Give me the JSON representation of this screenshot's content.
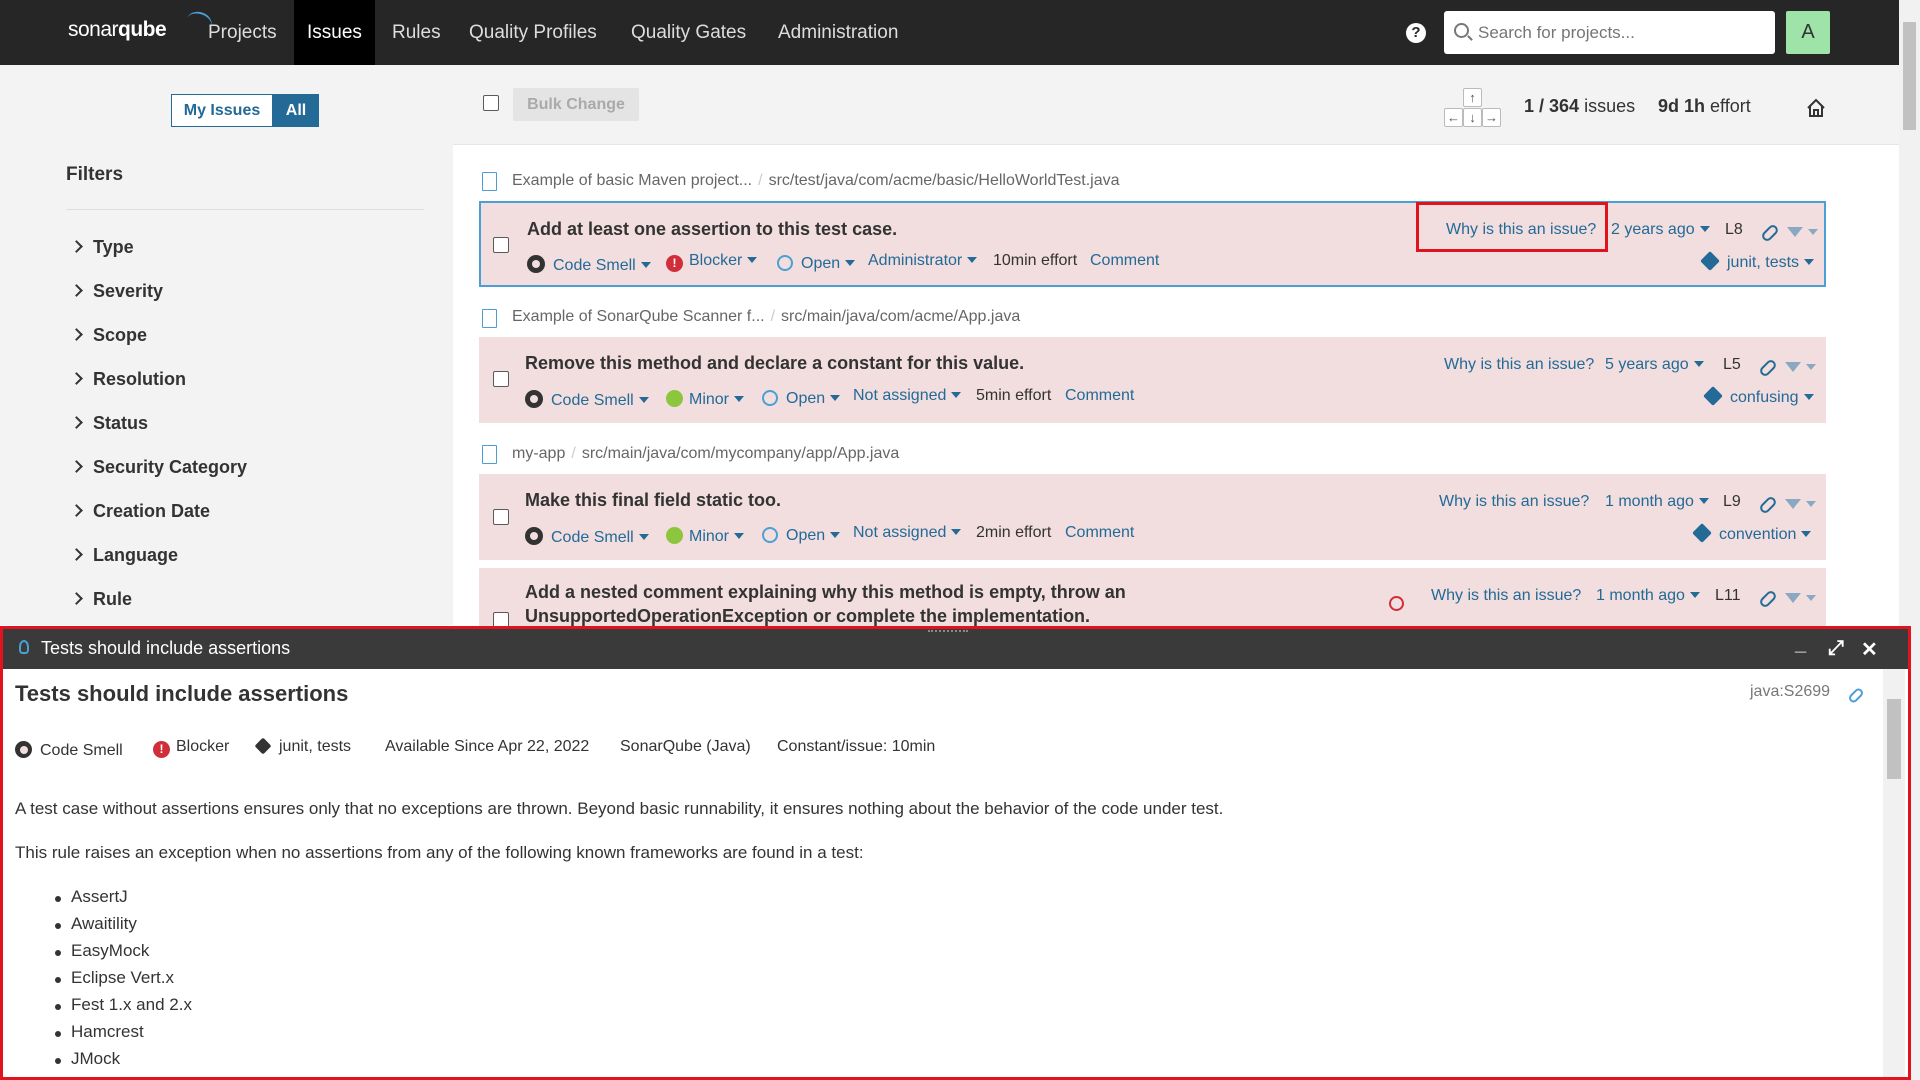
{
  "nav": {
    "logo_a": "sonar",
    "logo_b": "qube",
    "items": [
      "Projects",
      "Issues",
      "Rules",
      "Quality Profiles",
      "Quality Gates",
      "Administration"
    ],
    "help": "?",
    "search_placeholder": "Search for projects...",
    "avatar": "A"
  },
  "sidebar": {
    "my_issues": "My Issues",
    "all": "All",
    "filters_title": "Filters",
    "facets": [
      "Type",
      "Severity",
      "Scope",
      "Resolution",
      "Status",
      "Security Category",
      "Creation Date",
      "Language",
      "Rule"
    ]
  },
  "toolbar": {
    "bulk_change": "Bulk Change",
    "keys": {
      "up": "↑",
      "left": "←",
      "down": "↓",
      "right": "→"
    },
    "count_current": "1",
    "count_sep": " / ",
    "count_total": "364",
    "count_label": " issues",
    "effort_value": "9d 1h",
    "effort_label": " effort"
  },
  "issues": [
    {
      "project": "Example of basic Maven project...",
      "path": "src/test/java/com/acme/basic/HelloWorldTest.java",
      "title": "Add at least one assertion to this test case.",
      "type": "Code Smell",
      "severity": "Blocker",
      "status": "Open",
      "assignee": "Administrator",
      "effort": "10min effort",
      "comment": "Comment",
      "why": "Why is this an issue?",
      "age": "2 years ago",
      "line": "L8",
      "tags": "junit, tests"
    },
    {
      "project": "Example of SonarQube Scanner f...",
      "path": "src/main/java/com/acme/App.java",
      "title": "Remove this method and declare a constant for this value.",
      "type": "Code Smell",
      "severity": "Minor",
      "status": "Open",
      "assignee": "Not assigned",
      "effort": "5min effort",
      "comment": "Comment",
      "why": "Why is this an issue?",
      "age": "5 years ago",
      "line": "L5",
      "tags": "confusing"
    },
    {
      "project": "my-app",
      "path": "src/main/java/com/mycompany/app/App.java",
      "title": "Make this final field static too.",
      "type": "Code Smell",
      "severity": "Minor",
      "status": "Open",
      "assignee": "Not assigned",
      "effort": "2min effort",
      "comment": "Comment",
      "why": "Why is this an issue?",
      "age": "1 month ago",
      "line": "L9",
      "tags": "convention"
    },
    {
      "title_line1": "Add a nested comment explaining why this method is empty, throw an",
      "title_line2": "UnsupportedOperationException or complete the implementation.",
      "why": "Why is this an issue?",
      "age": "1 month ago",
      "line": "L11"
    }
  ],
  "panel": {
    "header": "Tests should include assertions",
    "title": "Tests should include assertions",
    "rule_key": "java:S2699",
    "type": "Code Smell",
    "severity": "Blocker",
    "tags": "junit, tests",
    "available_since": "Available Since Apr 22, 2022",
    "engine": "SonarQube (Java)",
    "remediation": "Constant/issue: 10min",
    "para1": "A test case without assertions ensures only that no exceptions are thrown. Beyond basic runnability, it ensures nothing about the behavior of the code under test.",
    "para2": "This rule raises an exception when no assertions from any of the following known frameworks are found in a test:",
    "frameworks": [
      "AssertJ",
      "Awaitility",
      "EasyMock",
      "Eclipse Vert.x",
      "Fest 1.x and 2.x",
      "Hamcrest",
      "JMock"
    ]
  },
  "colors": {
    "topbar": "#262626",
    "accent": "#236a97",
    "issue_bg": "#f2dede",
    "highlight": "#e0141e"
  }
}
